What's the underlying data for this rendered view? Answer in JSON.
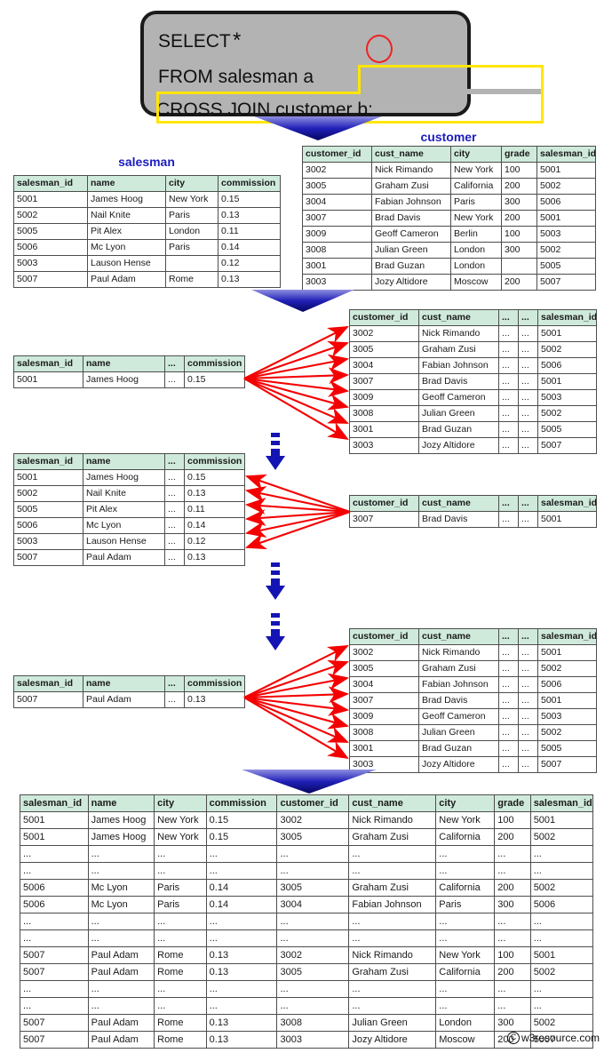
{
  "query": {
    "line1": "SELECT",
    "star": "*",
    "line2": "FROM salesman a",
    "line3": "CROSS JOIN customer b;"
  },
  "salesman_table": {
    "title": "salesman",
    "columns": [
      "salesman_id",
      "name",
      "city",
      "commission"
    ],
    "rows": [
      [
        "5001",
        "James Hoog",
        "New York",
        "0.15"
      ],
      [
        "5002",
        "Nail Knite",
        "Paris",
        "0.13"
      ],
      [
        "5005",
        "Pit Alex",
        "London",
        "0.11"
      ],
      [
        "5006",
        "Mc Lyon",
        "Paris",
        "0.14"
      ],
      [
        "5003",
        "Lauson Hense",
        "",
        "0.12"
      ],
      [
        "5007",
        "Paul Adam",
        "Rome",
        "0.13"
      ]
    ]
  },
  "customer_table": {
    "title": "customer",
    "columns": [
      "customer_id",
      "cust_name",
      "city",
      "grade",
      "salesman_id"
    ],
    "rows": [
      [
        "3002",
        "Nick Rimando",
        "New York",
        "100",
        "5001"
      ],
      [
        "3005",
        "Graham Zusi",
        "California",
        "200",
        "5002"
      ],
      [
        "3004",
        "Fabian Johnson",
        "Paris",
        "300",
        "5006"
      ],
      [
        "3007",
        "Brad Davis",
        "New York",
        "200",
        "5001"
      ],
      [
        "3009",
        "Geoff Cameron",
        "Berlin",
        "100",
        "5003"
      ],
      [
        "3008",
        "Julian Green",
        "London",
        "300",
        "5002"
      ],
      [
        "3001",
        "Brad Guzan",
        "London",
        "",
        "5005"
      ],
      [
        "3003",
        "Jozy Altidore",
        "Moscow",
        "200",
        "5007"
      ]
    ]
  },
  "step1": {
    "salesman_columns": [
      "salesman_id",
      "name",
      "...",
      "commission"
    ],
    "salesman_rows": [
      [
        "5001",
        "James Hoog",
        "...",
        "0.15"
      ]
    ],
    "customer_columns": [
      "customer_id",
      "cust_name",
      "...",
      "...",
      "salesman_id"
    ],
    "customer_rows": [
      [
        "3002",
        "Nick Rimando",
        "...",
        "...",
        "5001"
      ],
      [
        "3005",
        "Graham Zusi",
        "...",
        "...",
        "5002"
      ],
      [
        "3004",
        "Fabian Johnson",
        "...",
        "...",
        "5006"
      ],
      [
        "3007",
        "Brad Davis",
        "...",
        "...",
        "5001"
      ],
      [
        "3009",
        "Geoff Cameron",
        "...",
        "...",
        "5003"
      ],
      [
        "3008",
        "Julian Green",
        "...",
        "...",
        "5002"
      ],
      [
        "3001",
        "Brad Guzan",
        "...",
        "...",
        "5005"
      ],
      [
        "3003",
        "Jozy Altidore",
        "...",
        "...",
        "5007"
      ]
    ]
  },
  "step2": {
    "salesman_columns": [
      "salesman_id",
      "name",
      "...",
      "commission"
    ],
    "salesman_rows": [
      [
        "5001",
        "James Hoog",
        "...",
        "0.15"
      ],
      [
        "5002",
        "Nail Knite",
        "...",
        "0.13"
      ],
      [
        "5005",
        "Pit Alex",
        "...",
        "0.11"
      ],
      [
        "5006",
        "Mc Lyon",
        "...",
        "0.14"
      ],
      [
        "5003",
        "Lauson Hense",
        "...",
        "0.12"
      ],
      [
        "5007",
        "Paul Adam",
        "...",
        "0.13"
      ]
    ],
    "customer_columns": [
      "customer_id",
      "cust_name",
      "...",
      "...",
      "salesman_id"
    ],
    "customer_rows": [
      [
        "3007",
        "Brad Davis",
        "...",
        "...",
        "5001"
      ]
    ]
  },
  "step3": {
    "salesman_columns": [
      "salesman_id",
      "name",
      "...",
      "commission"
    ],
    "salesman_rows": [
      [
        "5007",
        "Paul Adam",
        "...",
        "0.13"
      ]
    ],
    "customer_columns": [
      "customer_id",
      "cust_name",
      "...",
      "...",
      "salesman_id"
    ],
    "customer_rows": [
      [
        "3002",
        "Nick Rimando",
        "...",
        "...",
        "5001"
      ],
      [
        "3005",
        "Graham Zusi",
        "...",
        "...",
        "5002"
      ],
      [
        "3004",
        "Fabian Johnson",
        "...",
        "...",
        "5006"
      ],
      [
        "3007",
        "Brad Davis",
        "...",
        "...",
        "5001"
      ],
      [
        "3009",
        "Geoff Cameron",
        "...",
        "...",
        "5003"
      ],
      [
        "3008",
        "Julian Green",
        "...",
        "...",
        "5002"
      ],
      [
        "3001",
        "Brad Guzan",
        "...",
        "...",
        "5005"
      ],
      [
        "3003",
        "Jozy Altidore",
        "...",
        "...",
        "5007"
      ]
    ]
  },
  "result_table": {
    "columns": [
      "salesman_id",
      "name",
      "city",
      "commission",
      "customer_id",
      "cust_name",
      "city",
      "grade",
      "salesman_id"
    ],
    "rows": [
      [
        "5001",
        "James Hoog",
        "New York",
        "0.15",
        "3002",
        "Nick Rimando",
        "New York",
        "100",
        "5001"
      ],
      [
        "5001",
        "James Hoog",
        "New York",
        "0.15",
        "3005",
        "Graham Zusi",
        "California",
        "200",
        "5002"
      ],
      [
        "...",
        "...",
        "...",
        "...",
        "...",
        "...",
        "...",
        "...",
        "..."
      ],
      [
        "...",
        "...",
        "...",
        "...",
        "...",
        "...",
        "...",
        "...",
        "..."
      ],
      [
        "5006",
        "Mc Lyon",
        "Paris",
        "0.14",
        "3005",
        "Graham Zusi",
        "California",
        "200",
        "5002"
      ],
      [
        "5006",
        "Mc Lyon",
        "Paris",
        "0.14",
        "3004",
        "Fabian Johnson",
        "Paris",
        "300",
        "5006"
      ],
      [
        "...",
        "...",
        "...",
        "...",
        "...",
        "...",
        "...",
        "...",
        "..."
      ],
      [
        "...",
        "...",
        "...",
        "...",
        "...",
        "...",
        "...",
        "...",
        "..."
      ],
      [
        "5007",
        "Paul Adam",
        "Rome",
        "0.13",
        "3002",
        "Nick Rimando",
        "New York",
        "100",
        "5001"
      ],
      [
        "5007",
        "Paul Adam",
        "Rome",
        "0.13",
        "3005",
        "Graham Zusi",
        "California",
        "200",
        "5002"
      ],
      [
        "...",
        "...",
        "...",
        "...",
        "...",
        "...",
        "...",
        "...",
        "..."
      ],
      [
        "...",
        "...",
        "...",
        "...",
        "...",
        "...",
        "...",
        "...",
        "..."
      ],
      [
        "5007",
        "Paul Adam",
        "Rome",
        "0.13",
        "3008",
        "Julian Green",
        "London",
        "300",
        "5002"
      ],
      [
        "5007",
        "Paul Adam",
        "Rome",
        "0.13",
        "3003",
        "Jozy Altidore",
        "Moscow",
        "200",
        "5007"
      ]
    ]
  },
  "footer": {
    "mark": "C",
    "text": "w3resource.com"
  },
  "colors": {
    "header_green": "#cfeadb",
    "title_blue": "#1c1cc0",
    "arrow_red": "#f40000",
    "arrow_blue": "#1414b4",
    "sql_bg": "#b3b3b3",
    "highlight_yellow": "#ffe600"
  }
}
